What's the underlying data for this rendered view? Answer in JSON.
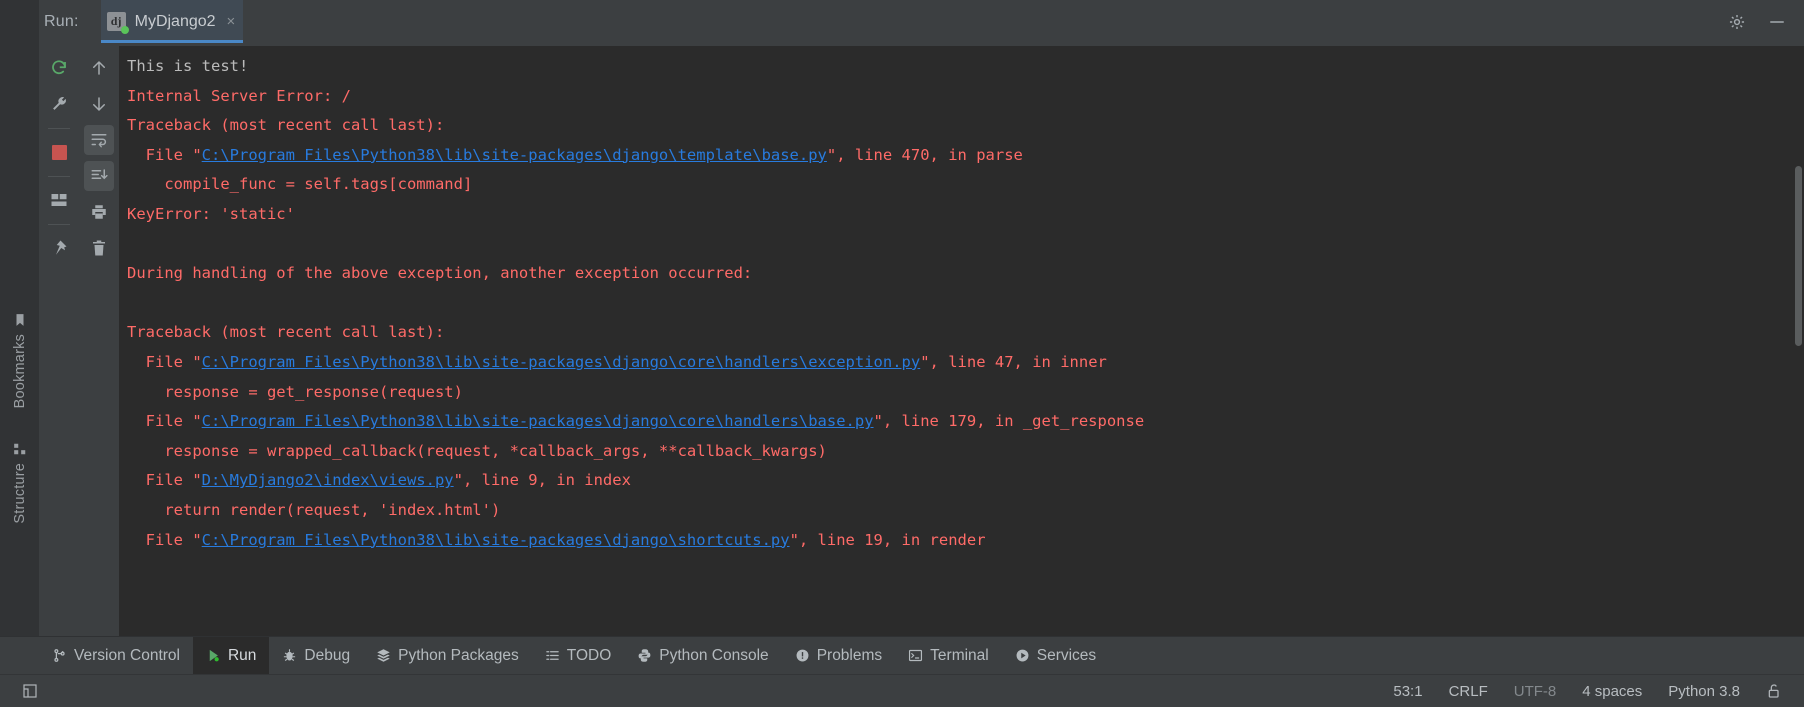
{
  "window": {
    "run_label": "Run:",
    "tab": {
      "icon": "django-icon",
      "label": "MyDjango2",
      "close": "×",
      "run_state": "running"
    },
    "settings_icon": "gear-icon",
    "minimize_icon": "minimize-icon"
  },
  "left_stripe": {
    "items": [
      {
        "label": "Bookmarks",
        "icon": "bookmark-icon"
      },
      {
        "label": "Structure",
        "icon": "structure-icon"
      }
    ]
  },
  "run_toolbar": {
    "column_one": [
      {
        "name": "rerun-button",
        "icon": "rerun-icon",
        "tooltip": "Rerun"
      },
      {
        "name": "edit-configuration-button",
        "icon": "wrench-icon",
        "tooltip": "Edit Configuration"
      },
      {
        "name": "stop-button",
        "icon": "stop-icon",
        "tooltip": "Stop"
      },
      {
        "name": "layout-button",
        "icon": "layout-icon",
        "tooltip": "Layout"
      },
      {
        "name": "pin-tab-button",
        "icon": "pin-icon",
        "tooltip": "Pin Tab"
      }
    ],
    "column_two": [
      {
        "name": "up-stack-button",
        "icon": "arrow-up-icon",
        "tooltip": "Up the Stack Trace"
      },
      {
        "name": "down-stack-button",
        "icon": "arrow-down-icon",
        "tooltip": "Down the Stack Trace"
      },
      {
        "name": "soft-wrap-button",
        "icon": "soft-wrap-icon",
        "tooltip": "Soft-Wrap",
        "selected": true
      },
      {
        "name": "scroll-to-end-button",
        "icon": "scroll-to-end-icon",
        "tooltip": "Scroll to the end",
        "selected": true
      },
      {
        "name": "print-button",
        "icon": "print-icon",
        "tooltip": "Print"
      },
      {
        "name": "clear-all-button",
        "icon": "trash-icon",
        "tooltip": "Clear All"
      }
    ]
  },
  "console": {
    "lines": [
      {
        "segments": [
          {
            "text": "This is test!",
            "style": "out"
          }
        ]
      },
      {
        "segments": [
          {
            "text": "Internal Server Error: /",
            "style": "err"
          }
        ]
      },
      {
        "segments": [
          {
            "text": "Traceback (most recent call last):",
            "style": "err"
          }
        ]
      },
      {
        "segments": [
          {
            "text": "  File \"",
            "style": "err"
          },
          {
            "text": "C:\\Program Files\\Python38\\lib\\site-packages\\django\\template\\base.py",
            "style": "link"
          },
          {
            "text": "\", line 470, in parse",
            "style": "err"
          }
        ]
      },
      {
        "segments": [
          {
            "text": "    compile_func = self.tags[command]",
            "style": "err"
          }
        ]
      },
      {
        "segments": [
          {
            "text": "KeyError: 'static'",
            "style": "err"
          }
        ]
      },
      {
        "segments": [
          {
            "text": "",
            "style": "err"
          }
        ]
      },
      {
        "segments": [
          {
            "text": "During handling of the above exception, another exception occurred:",
            "style": "err"
          }
        ]
      },
      {
        "segments": [
          {
            "text": "",
            "style": "err"
          }
        ]
      },
      {
        "segments": [
          {
            "text": "Traceback (most recent call last):",
            "style": "err"
          }
        ]
      },
      {
        "segments": [
          {
            "text": "  File \"",
            "style": "err"
          },
          {
            "text": "C:\\Program Files\\Python38\\lib\\site-packages\\django\\core\\handlers\\exception.py",
            "style": "link"
          },
          {
            "text": "\", line 47, in inner",
            "style": "err"
          }
        ]
      },
      {
        "segments": [
          {
            "text": "    response = get_response(request)",
            "style": "err"
          }
        ]
      },
      {
        "segments": [
          {
            "text": "  File \"",
            "style": "err"
          },
          {
            "text": "C:\\Program Files\\Python38\\lib\\site-packages\\django\\core\\handlers\\base.py",
            "style": "link"
          },
          {
            "text": "\", line 179, in _get_response",
            "style": "err"
          }
        ]
      },
      {
        "segments": [
          {
            "text": "    response = wrapped_callback(request, *callback_args, **callback_kwargs)",
            "style": "err"
          }
        ]
      },
      {
        "segments": [
          {
            "text": "  File \"",
            "style": "err"
          },
          {
            "text": "D:\\MyDjango2\\index\\views.py",
            "style": "link"
          },
          {
            "text": "\", line 9, in index",
            "style": "err"
          }
        ]
      },
      {
        "segments": [
          {
            "text": "    return render(request, 'index.html')",
            "style": "err"
          }
        ]
      },
      {
        "segments": [
          {
            "text": "  File \"",
            "style": "err"
          },
          {
            "text": "C:\\Program Files\\Python38\\lib\\site-packages\\django\\shortcuts.py",
            "style": "link"
          },
          {
            "text": "\", line 19, in render",
            "style": "err"
          }
        ]
      }
    ],
    "colors": {
      "background": "#2b2b2b",
      "stdout": "#bbbbbb",
      "stderr": "#ff6b68",
      "hyperlink": "#287bde"
    }
  },
  "bottom_tabs": [
    {
      "label": "Version Control",
      "icon": "branch-icon",
      "active": false
    },
    {
      "label": "Run",
      "icon": "run-icon",
      "active": true
    },
    {
      "label": "Debug",
      "icon": "bug-icon",
      "active": false
    },
    {
      "label": "Python Packages",
      "icon": "packages-icon",
      "active": false
    },
    {
      "label": "TODO",
      "icon": "todo-list-icon",
      "active": false
    },
    {
      "label": "Python Console",
      "icon": "python-icon",
      "active": false
    },
    {
      "label": "Problems",
      "icon": "problems-icon",
      "active": false
    },
    {
      "label": "Terminal",
      "icon": "terminal-icon",
      "active": false
    },
    {
      "label": "Services",
      "icon": "services-icon",
      "active": false
    }
  ],
  "status_bar": {
    "project_widget_icon": "project-window-icon",
    "caret_position": "53:1",
    "line_separator": "CRLF",
    "encoding": "UTF-8",
    "indent": "4 spaces",
    "interpreter": "Python 3.8",
    "lock_icon": "unlocked-icon"
  }
}
